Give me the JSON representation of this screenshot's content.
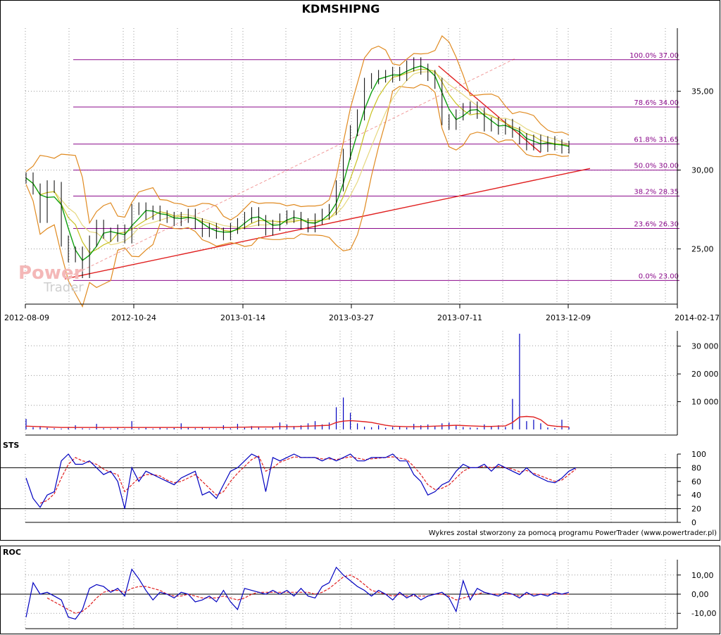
{
  "chart_data": {
    "type": "line",
    "title": "KDMSHIPNG",
    "watermark": {
      "line1": "Power",
      "line2": "Trader"
    },
    "credit": "Wykres został stworzony za pomocą programu PowerTrader (www.powertrader.pl)",
    "colors": {
      "price": "#000000",
      "fib": "#8b0a8b",
      "trend": "#e02020",
      "bands": "#e08a20",
      "ma_short": "#10a010",
      "ma_mid": "#c8c020",
      "ma_long": "#e6d880",
      "volume": "#0000c0",
      "volume_ma": "#e02020",
      "sts_k": "#0000c0",
      "sts_d": "#e02020",
      "roc": "#0000c0",
      "roc_signal": "#e02020",
      "grid": "#9a9a9a"
    },
    "x_axis": {
      "ticks": [
        "2012-08-09",
        "2012-10-24",
        "2013-01-14",
        "2013-03-27",
        "2013-07-11",
        "2013-12-09",
        "2014-02-17"
      ]
    },
    "price_panel": {
      "ylim": [
        21.5,
        39.0
      ],
      "y_ticks": [
        25,
        30,
        35
      ],
      "y_tick_labels": [
        "25,00",
        "30,00",
        "35,00"
      ],
      "fib_levels": [
        {
          "label": "100.0% 37.00",
          "value": 37.0
        },
        {
          "label": "78.6% 34.00",
          "value": 34.0
        },
        {
          "label": "61.8% 31.65",
          "value": 31.65
        },
        {
          "label": "50.0% 30.00",
          "value": 30.0
        },
        {
          "label": "38.2% 28.35",
          "value": 28.35
        },
        {
          "label": "23.6% 26.30",
          "value": 26.3
        },
        {
          "label": "0.0% 23.00",
          "value": 23.0
        }
      ],
      "close": [
        29.5,
        28.8,
        27.0,
        29.0,
        28.9,
        25.5,
        24.5,
        24.8,
        23.5,
        25.5,
        26.5,
        26.0,
        25.8,
        26.2,
        25.7,
        27.5,
        27.6,
        27.2,
        27.4,
        27.1,
        27.0,
        26.8,
        27.0,
        27.2,
        26.6,
        26.1,
        26.3,
        26.0,
        25.9,
        26.3,
        26.6,
        27.0,
        27.3,
        26.8,
        26.2,
        26.5,
        26.9,
        27.1,
        27.0,
        26.6,
        26.4,
        26.9,
        27.2,
        27.5,
        29.0,
        31.0,
        32.5,
        33.5,
        35.5,
        35.8,
        36.0,
        35.9,
        36.2,
        36.0,
        36.6,
        36.8,
        36.4,
        36.0,
        35.5,
        33.2,
        32.9,
        33.5,
        33.9,
        34.0,
        33.6,
        32.8,
        33.0,
        32.6,
        32.9,
        32.4,
        32.0,
        31.6,
        31.9,
        31.5,
        31.8,
        31.6,
        31.4,
        31.5
      ]
    },
    "trend_lines": [
      {
        "name": "support",
        "from": [
          5.5,
          23.1
        ],
        "to": [
          80.0,
          30.1
        ]
      },
      {
        "name": "resistance",
        "from": [
          58.5,
          36.6
        ],
        "to": [
          73.0,
          31.1
        ]
      },
      {
        "name": "support-extension",
        "from": [
          5.5,
          23.1
        ],
        "to": [
          69.5,
          37.1
        ]
      }
    ],
    "volume_panel": {
      "ylim": [
        0,
        35000
      ],
      "y_ticks": [
        10000,
        20000,
        30000
      ],
      "y_tick_labels": [
        "10 000",
        "20 000",
        "30 000"
      ],
      "values": [
        3800,
        800,
        1200,
        600,
        400,
        300,
        900,
        1500,
        400,
        300,
        2000,
        400,
        300,
        500,
        300,
        3000,
        400,
        600,
        300,
        700,
        400,
        500,
        2200,
        900,
        400,
        800,
        400,
        300,
        1500,
        400,
        2000,
        600,
        1200,
        700,
        300,
        900,
        2500,
        1800,
        1200,
        1500,
        2200,
        3000,
        1800,
        2500,
        8000,
        11500,
        6000,
        2200,
        1000,
        800,
        1500,
        600,
        900,
        1200,
        700,
        2000,
        1500,
        1800,
        1200,
        2200,
        2500,
        1500,
        900,
        700,
        600,
        1800,
        1200,
        1500,
        900,
        11000,
        34500,
        3000,
        3500,
        2200,
        700,
        500,
        3500,
        900
      ],
      "ma": [
        1200,
        1100,
        1000,
        900,
        800,
        700,
        700,
        700,
        700,
        700,
        700,
        700,
        700,
        700,
        700,
        700,
        700,
        700,
        700,
        700,
        700,
        700,
        700,
        700,
        700,
        700,
        700,
        700,
        700,
        700,
        800,
        800,
        900,
        900,
        900,
        900,
        1000,
        1000,
        1000,
        1100,
        1200,
        1300,
        1400,
        1500,
        2500,
        3000,
        3200,
        3000,
        2800,
        2500,
        2000,
        1500,
        1200,
        1100,
        1000,
        1000,
        1000,
        1100,
        1200,
        1300,
        1400,
        1500,
        1400,
        1300,
        1200,
        1100,
        1100,
        1200,
        1300,
        2500,
        4500,
        4700,
        4500,
        3500,
        1500,
        1200,
        1000,
        900
      ]
    },
    "sts_panel": {
      "ylim": [
        0,
        100
      ],
      "y_ticks": [
        0,
        20,
        40,
        60,
        80,
        100
      ],
      "y_tick_labels": [
        "0",
        "20",
        "40",
        "60",
        "80",
        "100"
      ],
      "ref_lines": [
        20,
        80
      ],
      "k": [
        65,
        35,
        22,
        40,
        45,
        90,
        100,
        85,
        85,
        90,
        80,
        70,
        75,
        60,
        20,
        80,
        60,
        75,
        70,
        65,
        60,
        55,
        65,
        70,
        75,
        40,
        45,
        35,
        55,
        75,
        80,
        90,
        100,
        95,
        45,
        95,
        90,
        95,
        100,
        95,
        95,
        95,
        90,
        95,
        90,
        95,
        100,
        90,
        90,
        95,
        95,
        95,
        100,
        90,
        90,
        70,
        60,
        40,
        45,
        55,
        60,
        75,
        85,
        80,
        80,
        85,
        75,
        85,
        80,
        75,
        70,
        80,
        70,
        65,
        60,
        58,
        65,
        75,
        80
      ],
      "d": [
        null,
        null,
        28,
        32,
        42,
        65,
        85,
        95,
        90,
        88,
        85,
        78,
        73,
        70,
        45,
        55,
        65,
        70,
        70,
        68,
        62,
        58,
        60,
        65,
        70,
        60,
        50,
        40,
        45,
        60,
        72,
        82,
        92,
        97,
        75,
        80,
        88,
        92,
        96,
        95,
        95,
        95,
        93,
        93,
        92,
        94,
        96,
        94,
        92,
        93,
        94,
        95,
        96,
        94,
        92,
        82,
        70,
        55,
        48,
        50,
        55,
        65,
        75,
        80,
        80,
        82,
        80,
        82,
        80,
        78,
        74,
        76,
        72,
        68,
        64,
        60,
        62,
        70,
        78
      ]
    },
    "roc_panel": {
      "ylim": [
        -18,
        18
      ],
      "y_ticks": [
        -10,
        0,
        10
      ],
      "y_tick_labels": [
        "-10,00",
        "0,00",
        "10,00"
      ],
      "values": [
        -12,
        6,
        0,
        1,
        -1,
        -3,
        -12,
        -13,
        -8,
        3,
        5,
        4,
        1,
        3,
        -1,
        13,
        8,
        2,
        -3,
        1,
        0,
        -2,
        1,
        0,
        -4,
        -3,
        -1,
        -4,
        2,
        -4,
        -8,
        3,
        2,
        1,
        0,
        2,
        0,
        2,
        -1,
        3,
        -1,
        -2,
        4,
        6,
        14,
        10,
        7,
        4,
        2,
        -1,
        2,
        0,
        -3,
        1,
        -2,
        0,
        -3,
        -1,
        0,
        1,
        -2,
        -9,
        7,
        -3,
        3,
        1,
        0,
        -1,
        1,
        0,
        -2,
        1,
        -1,
        0,
        -1,
        1,
        0,
        1
      ],
      "signal": [
        null,
        null,
        null,
        -2,
        -4,
        -6,
        -8,
        -10,
        -9,
        -6,
        -2,
        1,
        2,
        2,
        1,
        3,
        4,
        4,
        3,
        2,
        0,
        -1,
        -1,
        0,
        -1,
        -2,
        -2,
        -2,
        -1,
        -2,
        -3,
        -2,
        0,
        1,
        1,
        1,
        1,
        1,
        1,
        1,
        1,
        0,
        1,
        3,
        6,
        9,
        10,
        8,
        5,
        2,
        1,
        0,
        -1,
        0,
        -1,
        -1,
        -1,
        -1,
        0,
        0,
        -1,
        -3,
        -2,
        -1,
        0,
        1,
        0,
        0,
        0,
        0,
        -1,
        0,
        0,
        0,
        0,
        0,
        0,
        0
      ]
    }
  }
}
